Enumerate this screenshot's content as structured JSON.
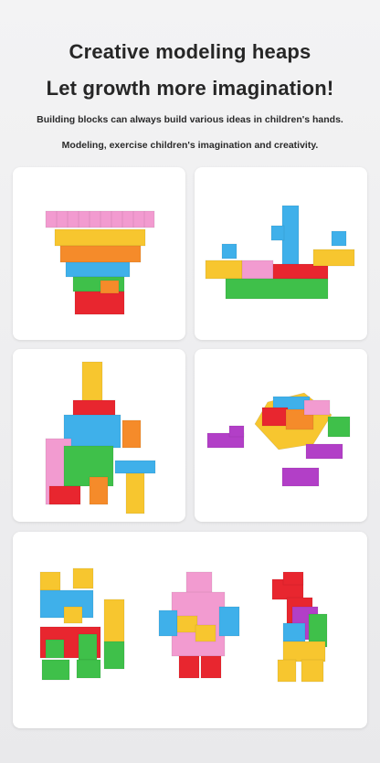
{
  "header": {
    "title_line1": "Creative modeling heaps",
    "title_line2": "Let growth more imagination!",
    "subtitle_line1": "Building blocks can always build various ideas in children's hands.",
    "subtitle_line2": "Modeling, exercise children's imagination and creativity."
  },
  "colors": {
    "background": "#eeeef0",
    "card": "#ffffff",
    "pink": "#f29bd0",
    "yellow": "#f7c62f",
    "orange": "#f58b2a",
    "blue": "#3fb0ea",
    "green": "#3fc04a",
    "red": "#e8262f",
    "purple": "#b23fc7"
  },
  "gallery": {
    "images": [
      "tower-block-model",
      "boat-block-model",
      "robot-block-model",
      "turtle-block-model",
      "letter-block-model",
      "figure-block-model",
      "bird-block-model"
    ]
  }
}
